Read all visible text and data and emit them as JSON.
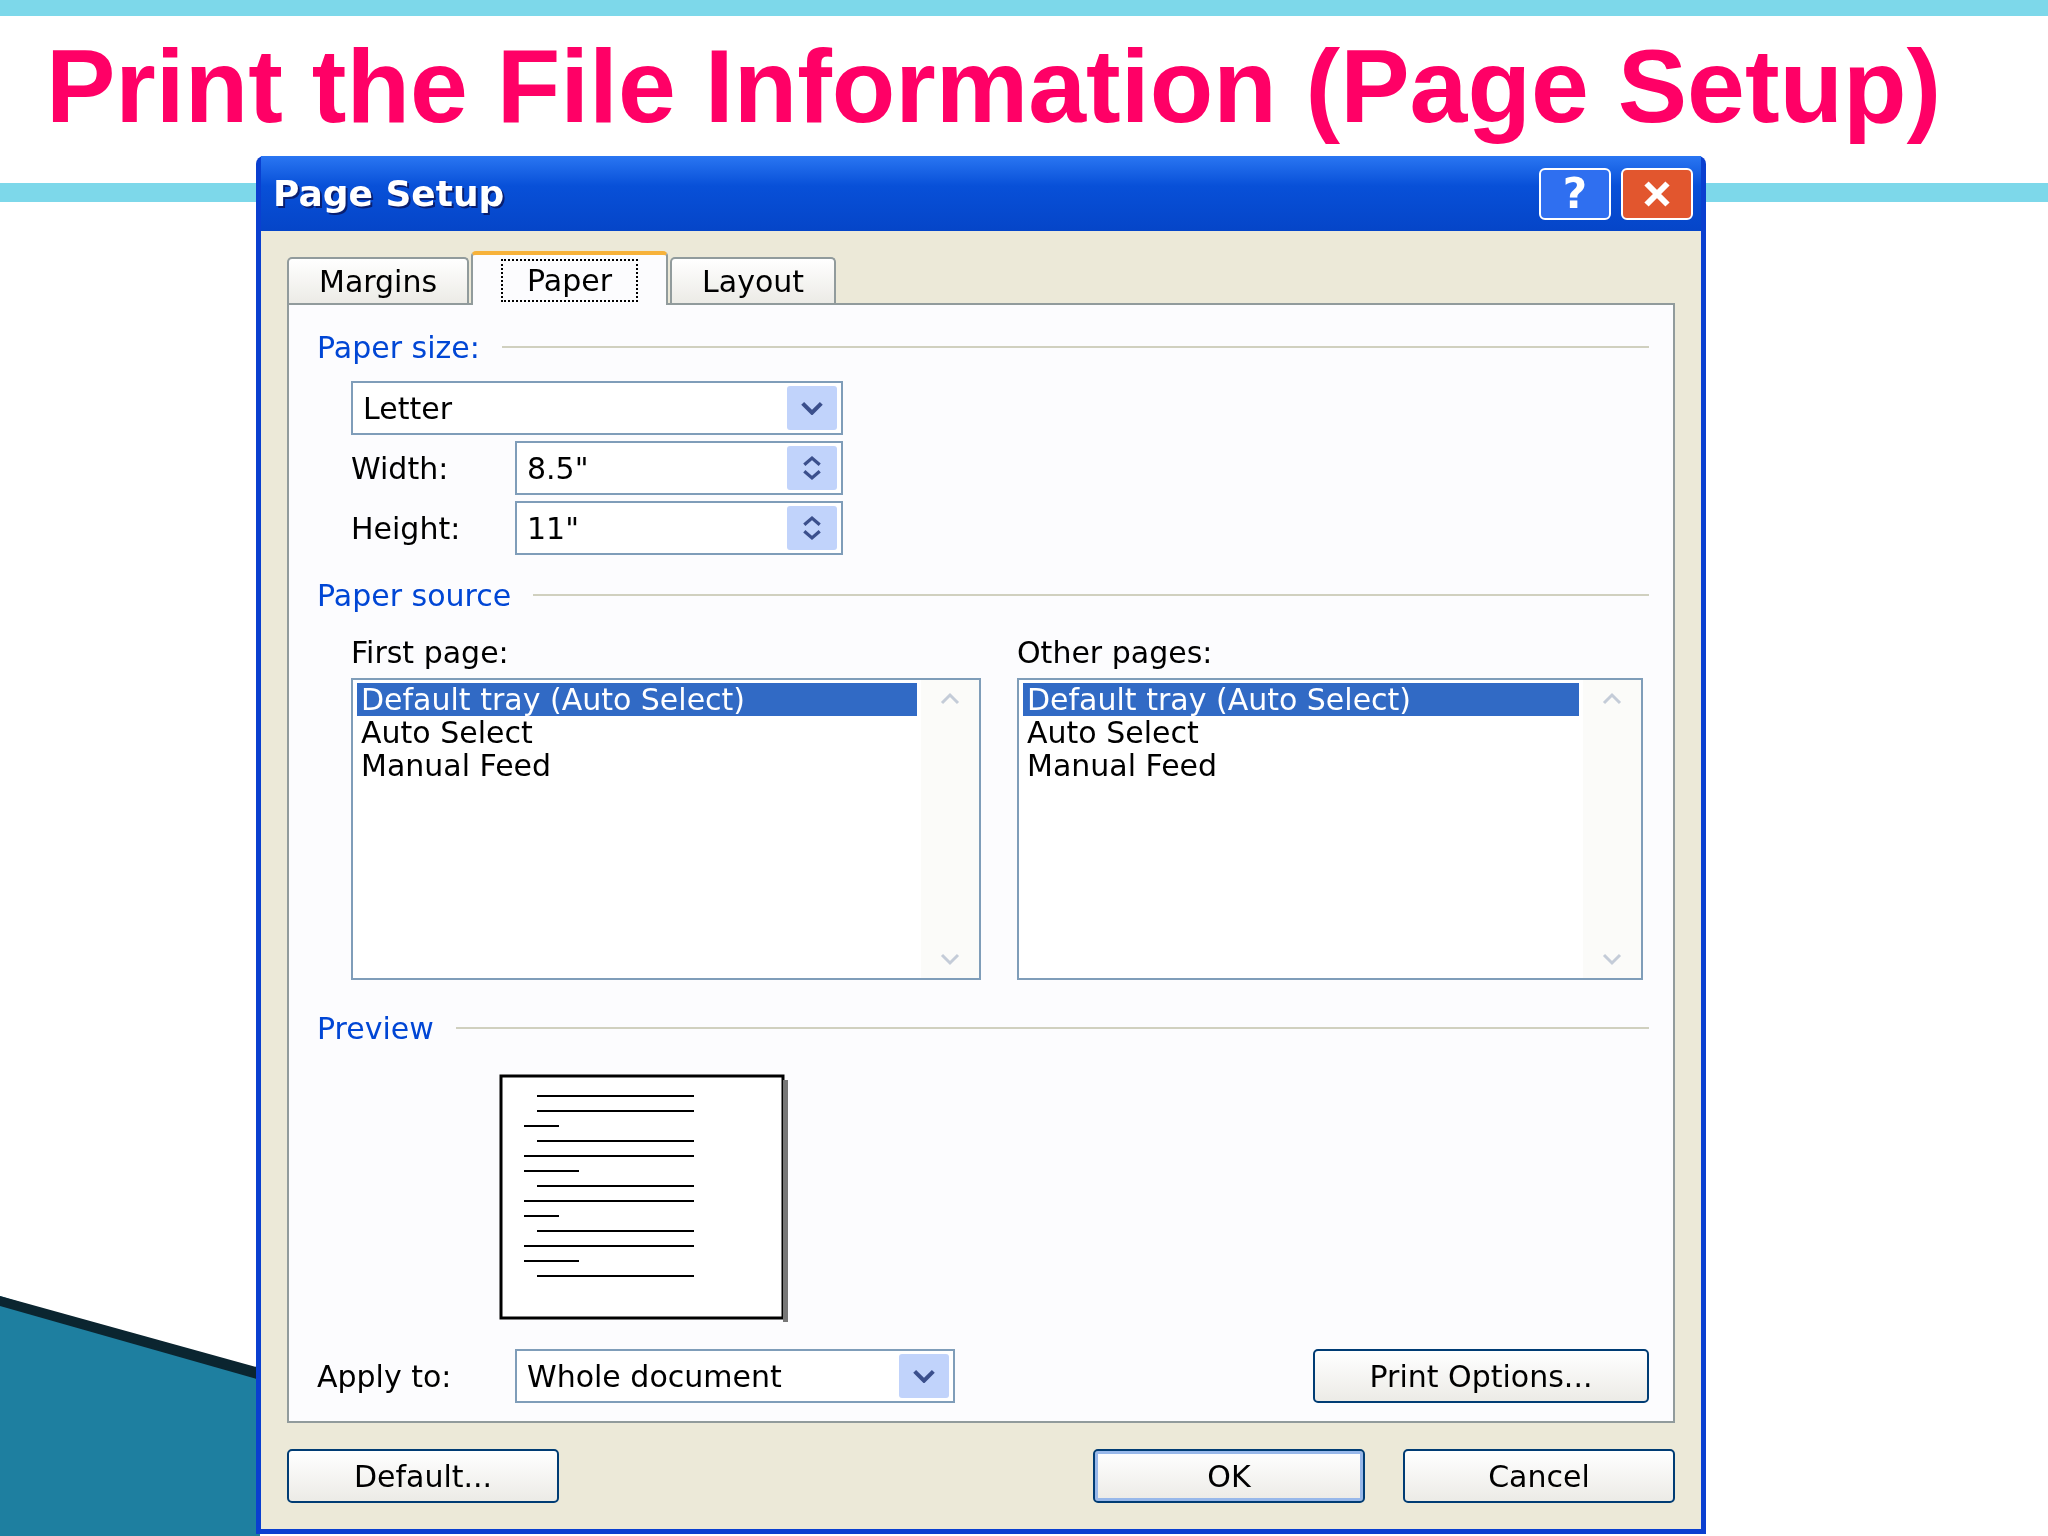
{
  "slide_title": "Print the File Information (Page Setup)",
  "dialog": {
    "title": "Page Setup",
    "help": "?"
  },
  "tabs": [
    {
      "label": "Margins",
      "selected": false
    },
    {
      "label": "Paper",
      "selected": true
    },
    {
      "label": "Layout",
      "selected": false
    }
  ],
  "paper_size": {
    "heading": "Paper size:",
    "value": "Letter",
    "width_label": "Width:",
    "width_value": "8.5\"",
    "height_label": "Height:",
    "height_value": "11\""
  },
  "paper_source": {
    "heading": "Paper source",
    "lists": [
      {
        "label": "First page:",
        "items": [
          {
            "text": "Default tray (Auto Select)",
            "selected": true
          },
          {
            "text": "Auto Select",
            "selected": false
          },
          {
            "text": "Manual Feed",
            "selected": false
          }
        ]
      },
      {
        "label": "Other pages:",
        "items": [
          {
            "text": "Default tray (Auto Select)",
            "selected": true
          },
          {
            "text": "Auto Select",
            "selected": false
          },
          {
            "text": "Manual Feed",
            "selected": false
          }
        ]
      }
    ]
  },
  "preview": {
    "heading": "Preview"
  },
  "apply_to": {
    "label": "Apply to:",
    "value": "Whole document"
  },
  "print_options": "Print Options...",
  "buttons": [
    {
      "label": "Default...",
      "focused": false
    },
    {
      "label": "OK",
      "focused": true
    },
    {
      "label": "Cancel",
      "focused": false
    }
  ]
}
